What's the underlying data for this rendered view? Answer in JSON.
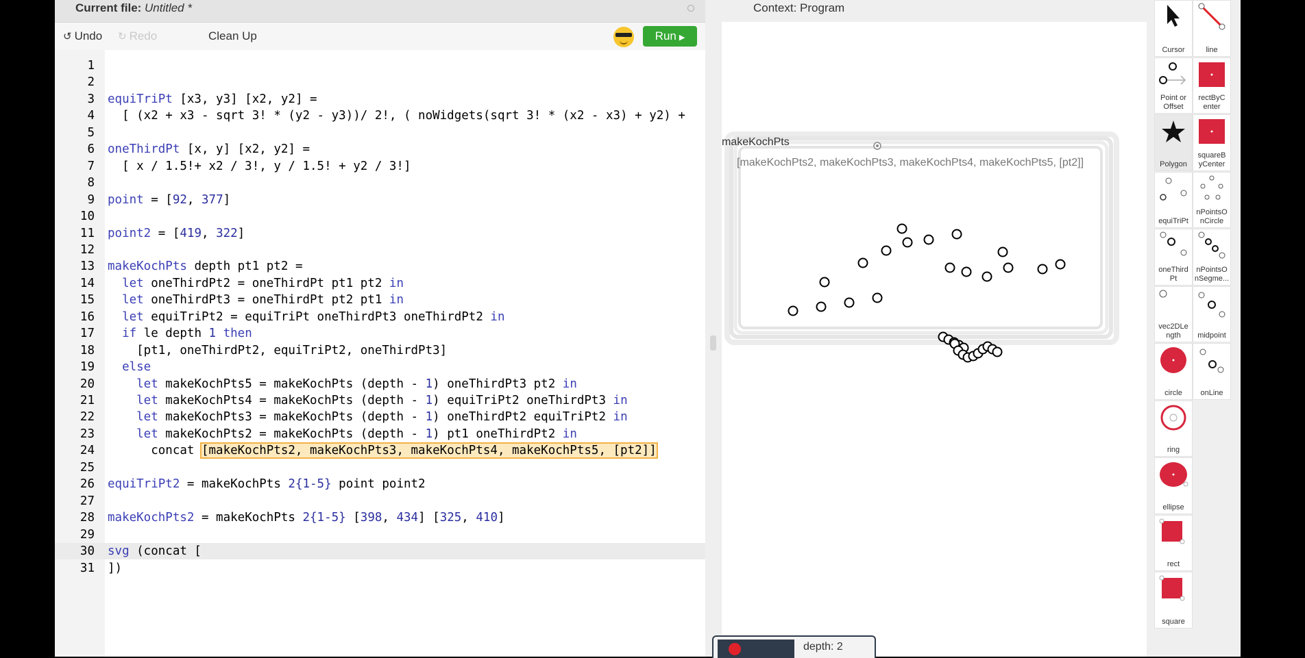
{
  "editor": {
    "header_label": "Current file:",
    "file_name": "Untitled *",
    "toolbar": {
      "undo_label": "Undo",
      "redo_label": "Redo",
      "cleanup_label": "Clean Up",
      "run_label": "Run"
    },
    "lines": [
      {
        "n": "1",
        "segs": []
      },
      {
        "n": "2",
        "segs": []
      },
      {
        "n": "3",
        "segs": [
          {
            "t": "equiTriPt",
            "c": "k"
          },
          {
            "t": " [x3, y3] [x2, y2] =",
            "c": ""
          }
        ]
      },
      {
        "n": "4",
        "segs": [
          {
            "t": "  [ (x2 + x3 - sqrt 3! * (y2 - y3))/ 2!, ( noWidgets(sqrt 3! * (x2 - x3) + y2) + ",
            "c": ""
          }
        ]
      },
      {
        "n": "5",
        "segs": []
      },
      {
        "n": "6",
        "segs": [
          {
            "t": "oneThirdPt",
            "c": "k"
          },
          {
            "t": " [x, y] [x2, y2] =",
            "c": ""
          }
        ]
      },
      {
        "n": "7",
        "segs": [
          {
            "t": "  [ x / 1.5!+ x2 / 3!, y / 1.5! + y2 / 3!]",
            "c": ""
          }
        ]
      },
      {
        "n": "8",
        "segs": []
      },
      {
        "n": "9",
        "segs": [
          {
            "t": "point",
            "c": "k"
          },
          {
            "t": " = [",
            "c": ""
          },
          {
            "t": "92",
            "c": "n"
          },
          {
            "t": ", ",
            "c": ""
          },
          {
            "t": "377",
            "c": "n"
          },
          {
            "t": "]",
            "c": ""
          }
        ]
      },
      {
        "n": "10",
        "segs": []
      },
      {
        "n": "11",
        "segs": [
          {
            "t": "point2",
            "c": "k"
          },
          {
            "t": " = [",
            "c": ""
          },
          {
            "t": "419",
            "c": "n"
          },
          {
            "t": ", ",
            "c": ""
          },
          {
            "t": "322",
            "c": "n"
          },
          {
            "t": "]",
            "c": ""
          }
        ]
      },
      {
        "n": "12",
        "segs": []
      },
      {
        "n": "13",
        "segs": [
          {
            "t": "makeKochPts",
            "c": "k"
          },
          {
            "t": " depth pt1 pt2 =",
            "c": ""
          }
        ]
      },
      {
        "n": "14",
        "segs": [
          {
            "t": "  let",
            "c": "k"
          },
          {
            "t": " oneThirdPt2 = oneThirdPt pt1 pt2 ",
            "c": ""
          },
          {
            "t": "in",
            "c": "k"
          }
        ]
      },
      {
        "n": "15",
        "segs": [
          {
            "t": "  let",
            "c": "k"
          },
          {
            "t": " oneThirdPt3 = oneThirdPt pt2 pt1 ",
            "c": ""
          },
          {
            "t": "in",
            "c": "k"
          }
        ]
      },
      {
        "n": "16",
        "segs": [
          {
            "t": "  let",
            "c": "k"
          },
          {
            "t": " equiTriPt2 = equiTriPt oneThirdPt3 oneThirdPt2 ",
            "c": ""
          },
          {
            "t": "in",
            "c": "k"
          }
        ]
      },
      {
        "n": "17",
        "segs": [
          {
            "t": "  if",
            "c": "k"
          },
          {
            "t": " le depth ",
            "c": ""
          },
          {
            "t": "1",
            "c": "n"
          },
          {
            "t": " ",
            "c": ""
          },
          {
            "t": "then",
            "c": "k"
          }
        ]
      },
      {
        "n": "18",
        "segs": [
          {
            "t": "    [pt1, oneThirdPt2, equiTriPt2, oneThirdPt3]",
            "c": ""
          }
        ]
      },
      {
        "n": "19",
        "segs": [
          {
            "t": "  else",
            "c": "k"
          }
        ]
      },
      {
        "n": "20",
        "segs": [
          {
            "t": "    let",
            "c": "k"
          },
          {
            "t": " makeKochPts5 = makeKochPts (depth - ",
            "c": ""
          },
          {
            "t": "1",
            "c": "n"
          },
          {
            "t": ") oneThirdPt3 pt2 ",
            "c": ""
          },
          {
            "t": "in",
            "c": "k"
          }
        ]
      },
      {
        "n": "21",
        "segs": [
          {
            "t": "    let",
            "c": "k"
          },
          {
            "t": " makeKochPts4 = makeKochPts (depth - ",
            "c": ""
          },
          {
            "t": "1",
            "c": "n"
          },
          {
            "t": ") equiTriPt2 oneThirdPt3 ",
            "c": ""
          },
          {
            "t": "in",
            "c": "k"
          }
        ]
      },
      {
        "n": "22",
        "segs": [
          {
            "t": "    let",
            "c": "k"
          },
          {
            "t": " makeKochPts3 = makeKochPts (depth - ",
            "c": ""
          },
          {
            "t": "1",
            "c": "n"
          },
          {
            "t": ") oneThirdPt2 equiTriPt2 ",
            "c": ""
          },
          {
            "t": "in",
            "c": "k"
          }
        ]
      },
      {
        "n": "23",
        "segs": [
          {
            "t": "    let",
            "c": "k"
          },
          {
            "t": " makeKochPts2 = makeKochPts (depth - ",
            "c": ""
          },
          {
            "t": "1",
            "c": "n"
          },
          {
            "t": ") pt1 oneThirdPt2 ",
            "c": ""
          },
          {
            "t": "in",
            "c": "k"
          }
        ]
      },
      {
        "n": "24",
        "segs": [
          {
            "t": "      concat ",
            "c": ""
          },
          {
            "t": "[makeKochPts2, makeKochPts3, makeKochPts4, makeKochPts5, [pt2]]",
            "c": "hl"
          }
        ]
      },
      {
        "n": "25",
        "segs": []
      },
      {
        "n": "26",
        "segs": [
          {
            "t": "equiTriPt2",
            "c": "k"
          },
          {
            "t": " = makeKochPts ",
            "c": ""
          },
          {
            "t": "2{1-5}",
            "c": "n"
          },
          {
            "t": " point point2",
            "c": ""
          }
        ]
      },
      {
        "n": "27",
        "segs": []
      },
      {
        "n": "28",
        "segs": [
          {
            "t": "makeKochPts2",
            "c": "k"
          },
          {
            "t": " = makeKochPts ",
            "c": ""
          },
          {
            "t": "2{1-5}",
            "c": "n"
          },
          {
            "t": " [",
            "c": ""
          },
          {
            "t": "398",
            "c": "n"
          },
          {
            "t": ", ",
            "c": ""
          },
          {
            "t": "434",
            "c": "n"
          },
          {
            "t": "] [",
            "c": ""
          },
          {
            "t": "325",
            "c": "n"
          },
          {
            "t": ", ",
            "c": ""
          },
          {
            "t": "410",
            "c": "n"
          },
          {
            "t": "]",
            "c": ""
          }
        ]
      },
      {
        "n": "29",
        "segs": []
      },
      {
        "n": "30",
        "segs": [
          {
            "t": "svg",
            "c": "k"
          },
          {
            "t": " (concat [",
            "c": ""
          }
        ]
      },
      {
        "n": "31",
        "segs": [
          {
            "t": "])",
            "c": ""
          }
        ]
      }
    ]
  },
  "canvas": {
    "header": "Context: Program",
    "widget_label": "makeKochPts",
    "list_label": "[makeKochPts2, makeKochPts3, makeKochPts4, makeKochPts5, [pt2]]",
    "bottom_label": "depth: 2"
  },
  "tools": [
    {
      "name": "cursor",
      "label": "Cursor"
    },
    {
      "name": "line",
      "label": "line"
    },
    {
      "name": "point-or-offset",
      "label": "Point or\nOffset"
    },
    {
      "name": "rect-by-center",
      "label": "rectByC\nenter"
    },
    {
      "name": "polygon",
      "label": "Polygon"
    },
    {
      "name": "square-by-center",
      "label": "squareB\nyCenter"
    },
    {
      "name": "equi-tri-pt",
      "label": "equiTriPt"
    },
    {
      "name": "n-points-on-circle",
      "label": "nPointsO\nnCircle"
    },
    {
      "name": "one-third-pt",
      "label": "oneThird\nPt"
    },
    {
      "name": "n-points-on-segment",
      "label": "nPointsO\nnSegme..."
    },
    {
      "name": "vec2d-length",
      "label": "vec2DLe\nngth"
    },
    {
      "name": "midpoint",
      "label": "midpoint"
    },
    {
      "name": "circle",
      "label": "circle"
    },
    {
      "name": "on-line",
      "label": "onLine"
    },
    {
      "name": "ring",
      "label": "ring"
    },
    {
      "name": "ellipse",
      "label": "ellipse"
    },
    {
      "name": "rect",
      "label": "rect"
    },
    {
      "name": "square",
      "label": "square"
    }
  ],
  "colors": {
    "run_green": "#35a834",
    "keyword_blue": "#3b3fb5",
    "highlight_orange": "#f3b244",
    "shape_red": "#e0222a"
  }
}
